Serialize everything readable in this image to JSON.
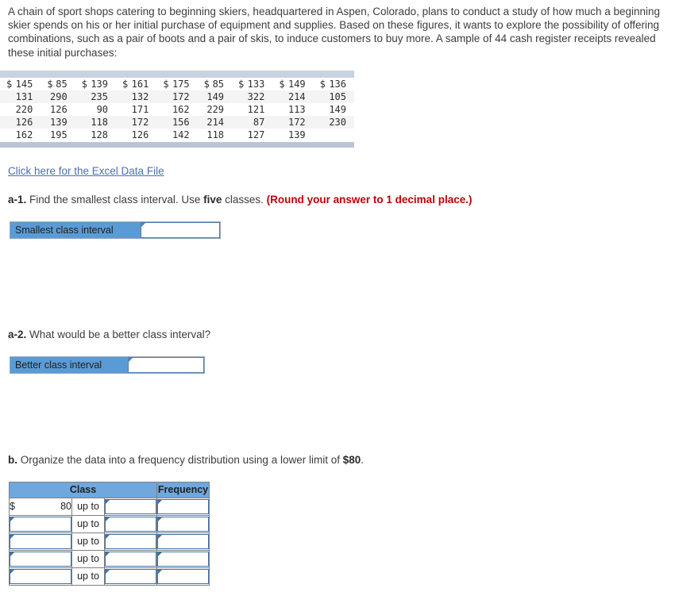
{
  "intro": {
    "paragraph": "A chain of sport shops catering to beginning skiers, headquartered in Aspen, Colorado, plans to conduct a study of how much a beginning skier spends on his or her initial purchase of equipment and supplies. Based on these figures, it wants to explore the possibility of offering combinations, such as a pair of boots and a pair of skis, to induce customers to buy more. A sample of 44 cash register receipts revealed these initial purchases:"
  },
  "data_table": {
    "currency_symbol": "$",
    "rows": [
      [
        "145",
        "85",
        "139",
        "161",
        "175",
        "85",
        "133",
        "149",
        "136"
      ],
      [
        "131",
        "290",
        "235",
        "132",
        "172",
        "149",
        "322",
        "214",
        "105"
      ],
      [
        "220",
        "126",
        "90",
        "171",
        "162",
        "229",
        "121",
        "113",
        "149"
      ],
      [
        "126",
        "139",
        "118",
        "172",
        "156",
        "214",
        "87",
        "172",
        "230"
      ],
      [
        "162",
        "195",
        "128",
        "126",
        "142",
        "118",
        "127",
        "139",
        ""
      ]
    ]
  },
  "excel_link": {
    "label": "Click here for the Excel Data File"
  },
  "question_a1": {
    "tag": "a-1.",
    "text_before": " Find the smallest class interval. Use ",
    "emphasis": "five",
    "text_after": " classes. ",
    "note": "(Round your answer to 1 decimal place.)",
    "answer": {
      "label": "Smallest class interval",
      "value": "",
      "placeholder": ""
    }
  },
  "question_a2": {
    "tag": "a-2.",
    "text": " What would be a better class interval?",
    "answer": {
      "label": "Better class interval",
      "value": "",
      "placeholder": ""
    }
  },
  "question_b": {
    "tag": "b.",
    "text_before": " Organize the data into a frequency distribution using a lower limit of ",
    "emphasis": "$80",
    "text_after": ".",
    "table": {
      "headers": {
        "class": "Class",
        "frequency": "Frequency"
      },
      "up_to_label": "up to",
      "currency_symbol": "$",
      "rows": [
        {
          "lower_symbol": "$",
          "lower": "80",
          "upper": "",
          "frequency": ""
        },
        {
          "lower_symbol": "",
          "lower": "",
          "upper": "",
          "frequency": ""
        },
        {
          "lower_symbol": "",
          "lower": "",
          "upper": "",
          "frequency": ""
        },
        {
          "lower_symbol": "",
          "lower": "",
          "upper": "",
          "frequency": ""
        },
        {
          "lower_symbol": "",
          "lower": "",
          "upper": "",
          "frequency": ""
        }
      ]
    }
  },
  "colors": {
    "accent_blue": "#5b9bd5",
    "header_blue": "#6fa8dc",
    "bar_blue_gray": "#c8d2e0",
    "link_blue": "#4a6fb5",
    "note_red": "#c00000"
  }
}
